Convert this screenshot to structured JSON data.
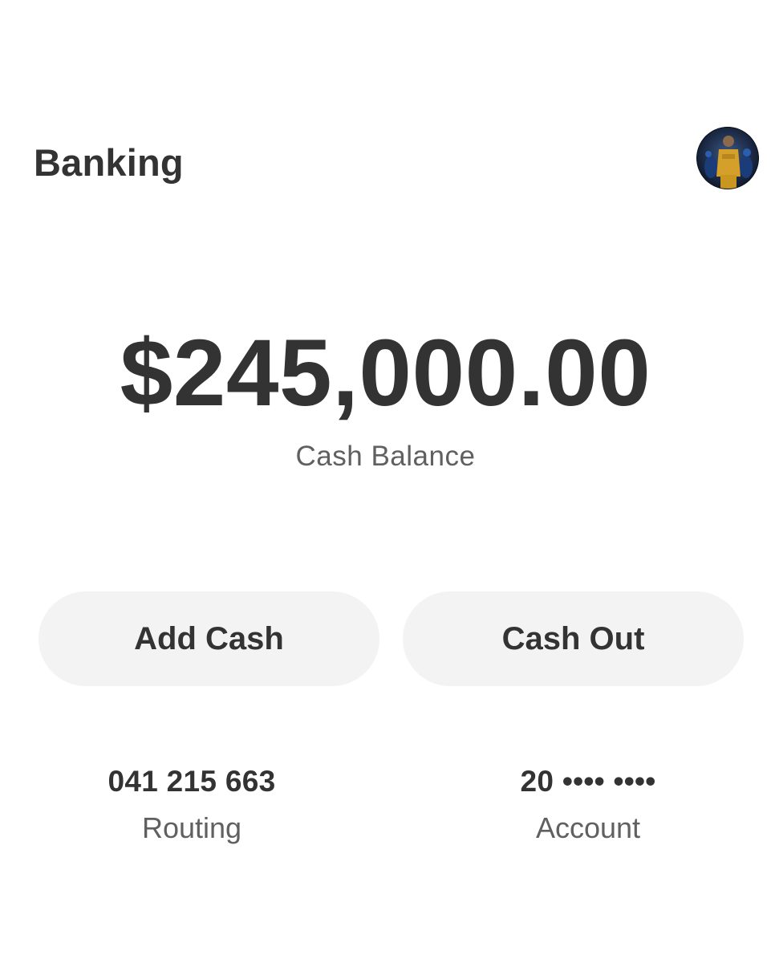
{
  "header": {
    "title": "Banking",
    "avatar_icon": "profile-avatar-icon"
  },
  "balance": {
    "amount": "$245,000.00",
    "label": "Cash Balance"
  },
  "actions": {
    "add_cash_label": "Add Cash",
    "cash_out_label": "Cash Out"
  },
  "details": {
    "routing_value": "041 215 663",
    "routing_label": "Routing",
    "account_value": "20 •••• ••••",
    "account_label": "Account"
  },
  "colors": {
    "text_primary": "#333333",
    "text_secondary": "#606060",
    "button_background": "#f3f3f3",
    "background": "#ffffff"
  }
}
